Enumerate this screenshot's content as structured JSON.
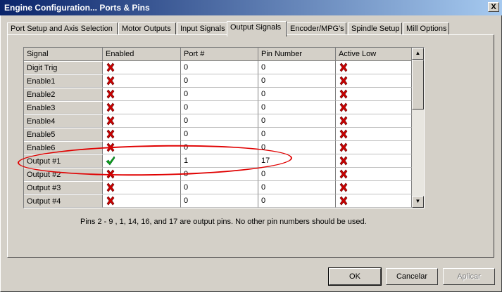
{
  "window": {
    "title": "Engine Configuration... Ports & Pins",
    "close_label": "X"
  },
  "tabs": [
    {
      "label": "Port Setup and Axis Selection"
    },
    {
      "label": "Motor Outputs"
    },
    {
      "label": "Input Signals"
    },
    {
      "label": "Output Signals",
      "active": true
    },
    {
      "label": "Encoder/MPG's"
    },
    {
      "label": "Spindle Setup"
    },
    {
      "label": "Mill Options"
    }
  ],
  "grid": {
    "columns": [
      "Signal",
      "Enabled",
      "Port #",
      "Pin Number",
      "Active Low"
    ],
    "rows": [
      {
        "signal": "Digit  Trig",
        "enabled": false,
        "port": "0",
        "pin": "0",
        "active_low": false
      },
      {
        "signal": "Enable1",
        "enabled": false,
        "port": "0",
        "pin": "0",
        "active_low": false
      },
      {
        "signal": "Enable2",
        "enabled": false,
        "port": "0",
        "pin": "0",
        "active_low": false
      },
      {
        "signal": "Enable3",
        "enabled": false,
        "port": "0",
        "pin": "0",
        "active_low": false
      },
      {
        "signal": "Enable4",
        "enabled": false,
        "port": "0",
        "pin": "0",
        "active_low": false
      },
      {
        "signal": "Enable5",
        "enabled": false,
        "port": "0",
        "pin": "0",
        "active_low": false
      },
      {
        "signal": "Enable6",
        "enabled": false,
        "port": "0",
        "pin": "0",
        "active_low": false
      },
      {
        "signal": "Output #1",
        "enabled": true,
        "port": "1",
        "pin": "17",
        "active_low": false
      },
      {
        "signal": "Output #2",
        "enabled": false,
        "port": "0",
        "pin": "0",
        "active_low": false
      },
      {
        "signal": "Output #3",
        "enabled": false,
        "port": "0",
        "pin": "0",
        "active_low": false
      },
      {
        "signal": "Output #4",
        "enabled": false,
        "port": "0",
        "pin": "0",
        "active_low": false
      }
    ]
  },
  "note": "Pins 2 - 9 , 1, 14, 16, and 17 are output pins. No  other pin numbers should be used.",
  "buttons": {
    "ok": "OK",
    "cancel": "Cancelar",
    "apply": "Aplicar"
  },
  "icons": {
    "enabled_true": "green-check-icon",
    "enabled_false": "red-x-icon"
  },
  "colors": {
    "title_start": "#0a246a",
    "title_end": "#a6caf0",
    "highlight": "#e00000",
    "x_red": "#cc0000",
    "check_green": "#10a010"
  }
}
